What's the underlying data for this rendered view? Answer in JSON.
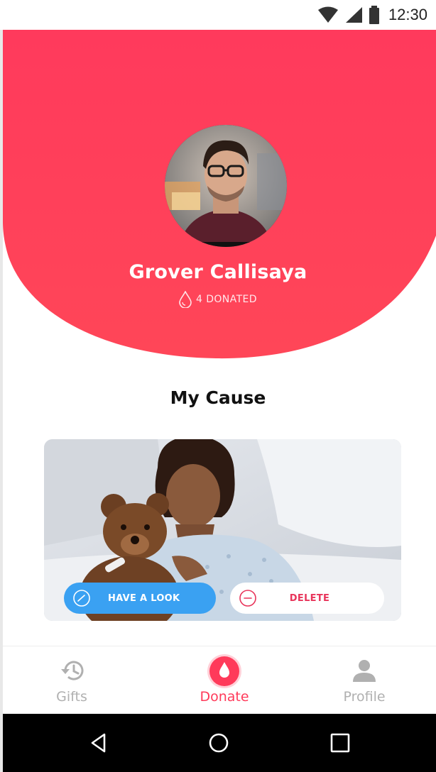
{
  "status_bar": {
    "time": "12:30",
    "icons": [
      "wifi-icon",
      "signal-icon",
      "battery-icon"
    ]
  },
  "profile": {
    "name": "Grover Callisaya",
    "donated_label": "4 DONATED",
    "avatar_icon": "avatar-photo"
  },
  "cause": {
    "title": "My Cause",
    "have_look_label": "HAVE A LOOK",
    "delete_label": "DELETE"
  },
  "tabs": [
    {
      "label": "Gifts",
      "icon": "history-icon",
      "active": false
    },
    {
      "label": "Donate",
      "icon": "blood-drop-icon",
      "active": true
    },
    {
      "label": "Profile",
      "icon": "person-icon",
      "active": false
    }
  ],
  "colors": {
    "primary": "#ff3a5a",
    "header_gradient_top": "#ff3a5c",
    "header_gradient_bottom": "#ff4658",
    "button_blue": "#3aa1f2",
    "inactive_tab": "#b0b0b0"
  },
  "nav_bar": {
    "icons": [
      "back-icon",
      "home-icon",
      "recents-icon"
    ]
  }
}
